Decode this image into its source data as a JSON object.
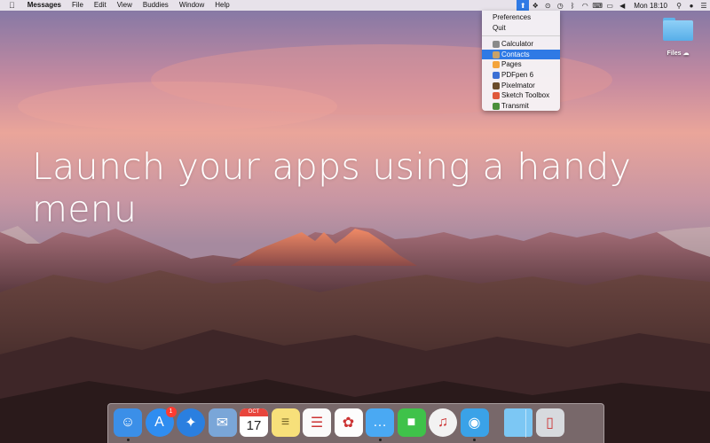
{
  "menubar": {
    "apple": "",
    "app_name": "Messages",
    "items": [
      "File",
      "Edit",
      "View",
      "Buddies",
      "Window",
      "Help"
    ],
    "clock": "Mon 18:10"
  },
  "dropdown": {
    "top_items": [
      "Preferences",
      "Quit"
    ],
    "apps": [
      {
        "label": "Calculator",
        "color": "#8a8a8a"
      },
      {
        "label": "Contacts",
        "color": "#c8a26a",
        "selected": true
      },
      {
        "label": "Pages",
        "color": "#f4a33a"
      },
      {
        "label": "PDFpen 6",
        "color": "#3b6fd4"
      },
      {
        "label": "Pixelmator",
        "color": "#6b4b2a"
      },
      {
        "label": "Sketch Toolbox",
        "color": "#e0583a"
      },
      {
        "label": "Transmit",
        "color": "#4a8f3a"
      }
    ]
  },
  "desktop": {
    "folder_label": "Files ☁"
  },
  "headline": "Launch your apps using a handy menu",
  "dock": {
    "apps": [
      {
        "name": "finder",
        "color": "#3b8fe8",
        "running": true
      },
      {
        "name": "app-store",
        "color": "#2f8df0",
        "badge": "1",
        "running": false
      },
      {
        "name": "safari",
        "color": "#2a7fe0",
        "running": false
      },
      {
        "name": "mail",
        "color": "#7aa6d8",
        "running": false
      },
      {
        "name": "calendar",
        "color": "#ffffff",
        "running": false,
        "month": "OCT",
        "day": "17"
      },
      {
        "name": "notes",
        "color": "#f7e07a",
        "running": false
      },
      {
        "name": "reminders",
        "color": "#fafafa",
        "running": false
      },
      {
        "name": "photos",
        "color": "#fdfdfd",
        "running": false
      },
      {
        "name": "messages",
        "color": "#4aa9f3",
        "running": true
      },
      {
        "name": "facetime",
        "color": "#3fc24a",
        "running": false
      },
      {
        "name": "itunes",
        "color": "#f2f2f2",
        "running": false
      },
      {
        "name": "tweetbot",
        "color": "#3aa2e8",
        "running": true
      },
      {
        "name": "folder",
        "color": "#7cc7f4",
        "running": false
      },
      {
        "name": "trash",
        "color": "#d7dade",
        "running": false
      }
    ]
  }
}
